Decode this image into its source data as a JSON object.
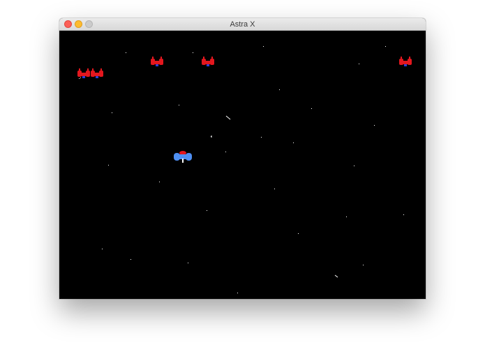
{
  "window": {
    "title": "Astra X",
    "buttons": [
      "close",
      "minimize",
      "zoom"
    ]
  },
  "game": {
    "background_color": "#000000",
    "star_color": "#ffffff",
    "enemy": {
      "icon": "enemy-fighter-icon",
      "color": "#e3171e",
      "accent": "#2b3fd6",
      "count": 5
    },
    "player": {
      "icon": "player-ship-icon",
      "color": "#4f8ff2",
      "accent": "#e3171e"
    }
  }
}
